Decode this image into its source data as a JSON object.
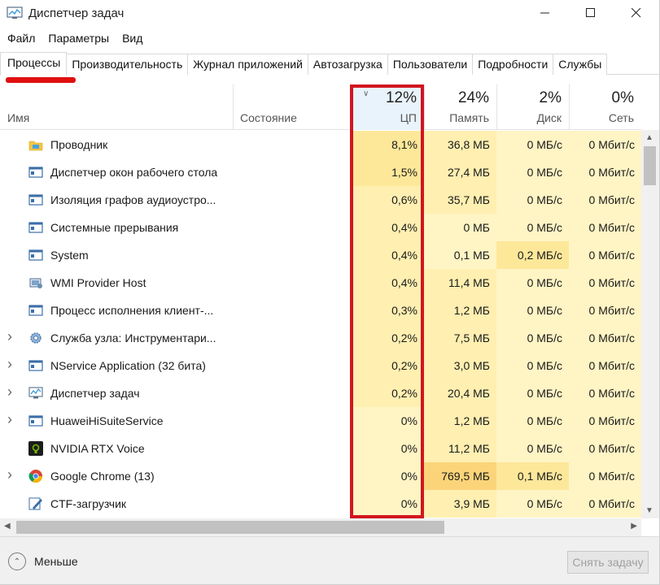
{
  "window": {
    "title": "Диспетчер задач"
  },
  "menu": [
    "Файл",
    "Параметры",
    "Вид"
  ],
  "tabs": [
    "Процессы",
    "Производительность",
    "Журнал приложений",
    "Автозагрузка",
    "Пользователи",
    "Подробности",
    "Службы"
  ],
  "active_tab": "Процессы",
  "columns": {
    "name": "Имя",
    "status": "Состояние",
    "cpu": {
      "pct": "12%",
      "label": "ЦП"
    },
    "mem": {
      "pct": "24%",
      "label": "Память"
    },
    "disk": {
      "pct": "2%",
      "label": "Диск"
    },
    "net": {
      "pct": "0%",
      "label": "Сеть"
    }
  },
  "rows": [
    {
      "name": "Проводник",
      "icon": "explorer-icon",
      "expand": false,
      "cpu": "8,1%",
      "mem": "36,8 МБ",
      "disk": "0 МБ/с",
      "net": "0 Мбит/с"
    },
    {
      "name": "Диспетчер окон рабочего стола",
      "icon": "window-app-icon",
      "expand": false,
      "cpu": "1,5%",
      "mem": "27,4 МБ",
      "disk": "0 МБ/с",
      "net": "0 Мбит/с"
    },
    {
      "name": "Изоляция графов аудиоустро...",
      "icon": "window-app-icon",
      "expand": false,
      "cpu": "0,6%",
      "mem": "35,7 МБ",
      "disk": "0 МБ/с",
      "net": "0 Мбит/с"
    },
    {
      "name": "Системные прерывания",
      "icon": "window-app-icon",
      "expand": false,
      "cpu": "0,4%",
      "mem": "0 МБ",
      "disk": "0 МБ/с",
      "net": "0 Мбит/с"
    },
    {
      "name": "System",
      "icon": "window-app-icon",
      "expand": false,
      "cpu": "0,4%",
      "mem": "0,1 МБ",
      "disk": "0,2 МБ/с",
      "net": "0 Мбит/с"
    },
    {
      "name": "WMI Provider Host",
      "icon": "wmi-icon",
      "expand": false,
      "cpu": "0,4%",
      "mem": "11,4 МБ",
      "disk": "0 МБ/с",
      "net": "0 Мбит/с"
    },
    {
      "name": "Процесс исполнения клиент-...",
      "icon": "window-app-icon",
      "expand": false,
      "cpu": "0,3%",
      "mem": "1,2 МБ",
      "disk": "0 МБ/с",
      "net": "0 Мбит/с"
    },
    {
      "name": "Служба узла: Инструментари...",
      "icon": "gear-service-icon",
      "expand": true,
      "cpu": "0,2%",
      "mem": "7,5 МБ",
      "disk": "0 МБ/с",
      "net": "0 Мбит/с"
    },
    {
      "name": "NService Application (32 бита)",
      "icon": "window-app-icon",
      "expand": true,
      "cpu": "0,2%",
      "mem": "3,0 МБ",
      "disk": "0 МБ/с",
      "net": "0 Мбит/с"
    },
    {
      "name": "Диспетчер задач",
      "icon": "task-manager-icon",
      "expand": true,
      "cpu": "0,2%",
      "mem": "20,4 МБ",
      "disk": "0 МБ/с",
      "net": "0 Мбит/с"
    },
    {
      "name": "HuaweiHiSuiteService",
      "icon": "window-app-icon",
      "expand": true,
      "cpu": "0%",
      "mem": "1,2 МБ",
      "disk": "0 МБ/с",
      "net": "0 Мбит/с"
    },
    {
      "name": "NVIDIA RTX Voice",
      "icon": "nvidia-icon",
      "expand": false,
      "cpu": "0%",
      "mem": "11,2 МБ",
      "disk": "0 МБ/с",
      "net": "0 Мбит/с"
    },
    {
      "name": "Google Chrome (13)",
      "icon": "chrome-icon",
      "expand": true,
      "cpu": "0%",
      "mem": "769,5 МБ",
      "disk": "0,1 МБ/с",
      "net": "0 Мбит/с"
    },
    {
      "name": "CTF-загрузчик",
      "icon": "ctf-pen-icon",
      "expand": false,
      "cpu": "0%",
      "mem": "3,9 МБ",
      "disk": "0 МБ/с",
      "net": "0 Мбит/с"
    }
  ],
  "footer": {
    "less": "Меньше",
    "end_task": "Снять задачу"
  },
  "colors": {
    "heat_light": "#fff4c4",
    "heat_mid": "#ffefb1",
    "heat_strong": "#fde89a",
    "highlight_box": "#d2151f",
    "underline": "#e01010"
  }
}
